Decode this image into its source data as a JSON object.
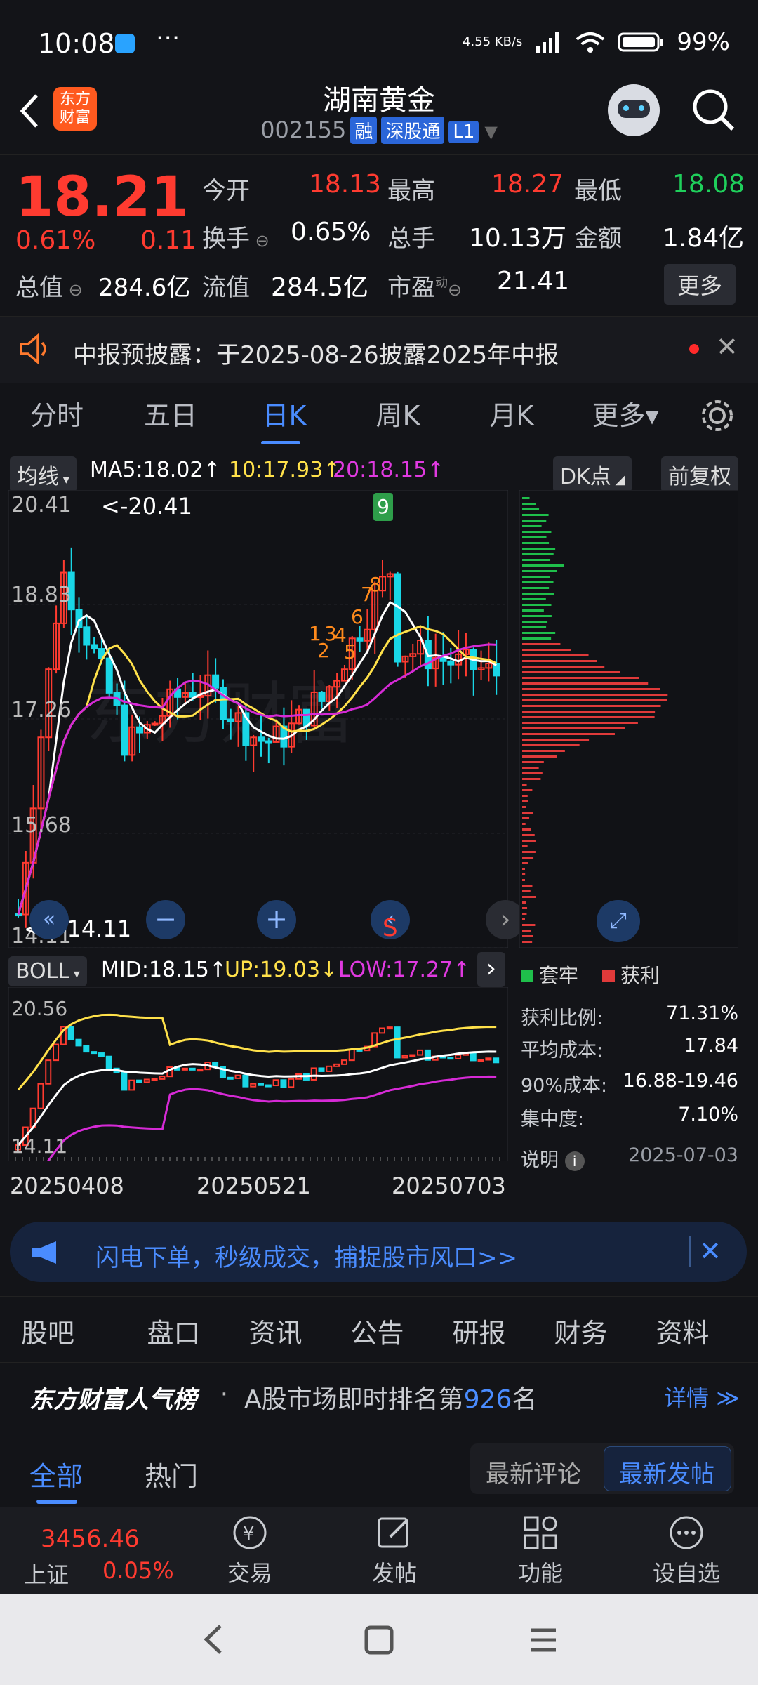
{
  "status": {
    "time": "10:08",
    "speed": "4.55 KB/s",
    "battery": "99%"
  },
  "header": {
    "title": "湖南黄金",
    "code": "002155",
    "tags": [
      "融",
      "深股通",
      "L1"
    ],
    "logo": "东方财富"
  },
  "quote": {
    "price": "18.21",
    "change_pct": "0.61%",
    "change": "0.11",
    "open_label": "今开",
    "open": "18.13",
    "high_label": "最高",
    "high": "18.27",
    "low_label": "最低",
    "low": "18.08",
    "turnover_label": "换手",
    "turnover": "0.65%",
    "volume_label": "总手",
    "volume": "10.13万",
    "amount_label": "金额",
    "amount": "1.84亿",
    "total_mv_label": "总值",
    "total_mv": "284.6亿",
    "float_mv_label": "流值",
    "float_mv": "284.5亿",
    "pe_label": "市盈",
    "pe_sup": "动",
    "pe": "21.41",
    "more_label": "更多"
  },
  "notice": {
    "text": "中报预披露：于2025-08-26披露2025年中报"
  },
  "periods": [
    "分时",
    "五日",
    "日K",
    "周K",
    "月K",
    "更多▾"
  ],
  "chart": {
    "ma_selector": "均线",
    "ma5": "MA5:18.02↑",
    "ma10": "10:17.93↑",
    "ma20": "20:18.15↑",
    "dk_label": "DK点",
    "adjust_label": "前复权",
    "y_ticks": [
      "20.41",
      "18.83",
      "17.26",
      "15.68",
      "14.11"
    ],
    "max_note": "<-20.41",
    "min_note": "<---14.11",
    "signal_top": "9",
    "signal_nums": [
      "1",
      "2",
      "3",
      "4",
      "5",
      "6",
      "7",
      "8"
    ],
    "s_marker": "S",
    "boll_selector": "BOLL",
    "boll_mid": "MID:18.15↑",
    "boll_up": "UP:19.03↓",
    "boll_low": "LOW:17.27↑",
    "boll_top": "20.56",
    "boll_bottom": "14.11",
    "dates": [
      "20250408",
      "20250521",
      "20250703"
    ],
    "legend_trapped": "套牢",
    "legend_profit": "获利",
    "colors": {
      "up": "#ff3b30",
      "down": "#19d6e6",
      "ma5": "#ffffff",
      "ma10": "#ffe14a",
      "ma20": "#d62ad6"
    }
  },
  "chips": {
    "profit_ratio_label": "获利比例:",
    "profit_ratio": "71.31%",
    "avg_cost_label": "平均成本:",
    "avg_cost": "17.84",
    "cost90_label": "90%成本:",
    "cost90": "16.88-19.46",
    "concentration_label": "集中度:",
    "concentration": "7.10%",
    "note_label": "说明",
    "date": "2025-07-03"
  },
  "ad": {
    "text": "闪电下单，秒级成交，捕捉股市风口>>"
  },
  "section_tabs": [
    "股吧",
    "盘口",
    "资讯",
    "公告",
    "研报",
    "财务",
    "资料"
  ],
  "rank": {
    "brand": "东方财富人气榜",
    "text_pre": "A股市场即时排名第",
    "rank": "926",
    "text_post": "名",
    "detail": "详情"
  },
  "feed_tabs": {
    "all": "全部",
    "hot": "热门",
    "latest_comment": "最新评论",
    "latest_post": "最新发帖"
  },
  "bottom": {
    "index_value": "3456.46",
    "index_name": "上证",
    "index_change": "0.05%",
    "items": [
      "交易",
      "发帖",
      "功能",
      "设自选"
    ]
  }
}
